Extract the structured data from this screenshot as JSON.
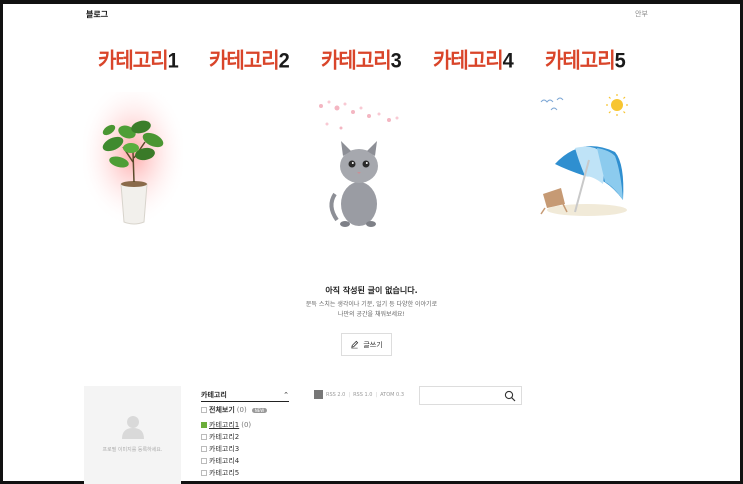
{
  "topbar": {
    "brand": "블로그",
    "help": "안부"
  },
  "categories": [
    {
      "title": "카테고리",
      "num": "1"
    },
    {
      "title": "카테고리",
      "num": "2"
    },
    {
      "title": "카테고리",
      "num": "3"
    },
    {
      "title": "카테고리",
      "num": "4"
    },
    {
      "title": "카테고리",
      "num": "5"
    }
  ],
  "empty": {
    "title": "아직 작성된 글이 없습니다.",
    "desc_line1": "문득 스치는 생각이나 기분, 일기 등 다양한 이야기로",
    "desc_line2": "나만의 공간을 채워보세요!",
    "write_label": "글쓰기"
  },
  "profile": {
    "placeholder": "프로필 이미지를 등록하세요."
  },
  "category_list": {
    "header": "카테고리",
    "all": {
      "label": "전체보기",
      "count": "(0)",
      "badge": "NEW"
    },
    "items": [
      {
        "label": "카테고리1",
        "count": "(0)"
      },
      {
        "label": "카테고리2",
        "count": ""
      },
      {
        "label": "카테고리3",
        "count": ""
      },
      {
        "label": "카테고리4",
        "count": ""
      },
      {
        "label": "카테고리5",
        "count": ""
      }
    ]
  },
  "rss": {
    "rss2": "RSS 2.0",
    "rss1": "RSS 1.0",
    "atom": "ATOM 0.3"
  },
  "search": {
    "placeholder": ""
  },
  "colors": {
    "title_red": "#d9452a",
    "title_num": "#1a1a1a",
    "checkbox_on": "#6cae3b"
  }
}
